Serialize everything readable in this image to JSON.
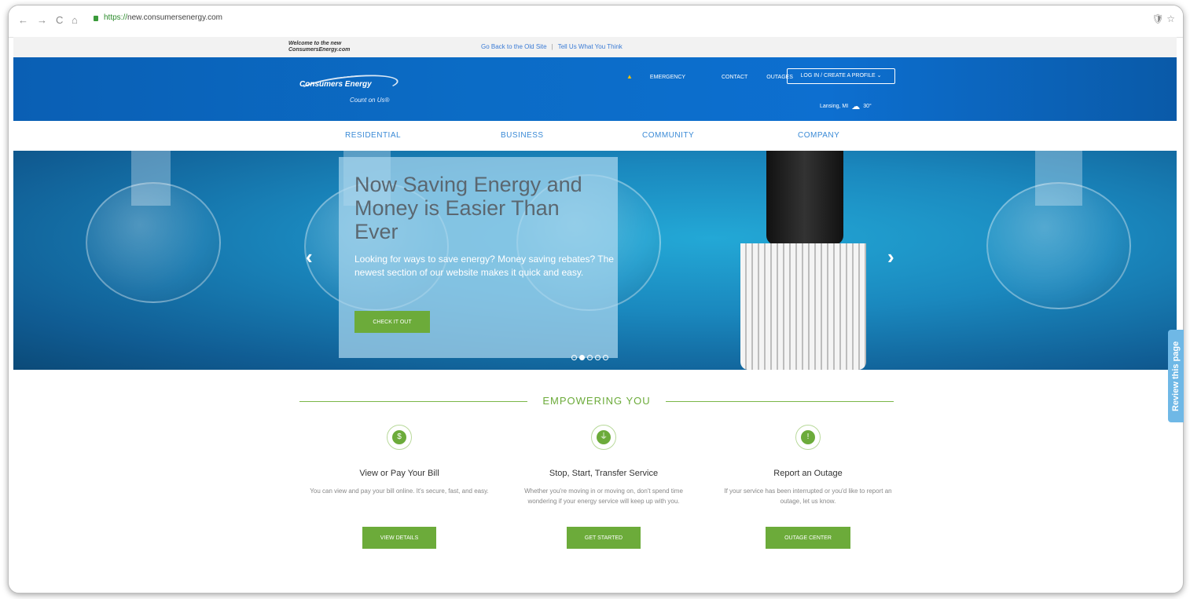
{
  "browser": {
    "back": "←",
    "forward": "→",
    "reload": "C",
    "home": "⌂",
    "url_scheme": "https://",
    "url_host": "new.consumersenergy.com",
    "right_icons": "🛡 ☆"
  },
  "topbar": {
    "welcome": "Welcome to the new ConsumersEnergy.com",
    "back_link": "Go Back to the Old Site",
    "separator": "|",
    "feedback_link": "Tell Us What You Think"
  },
  "header": {
    "logo_title": "Consumers Energy",
    "logo_tagline": "Count on Us®",
    "util_nav": [
      "EMERGENCY",
      "CONTACT",
      "OUTAGES"
    ],
    "login_label": "LOG IN / CREATE A PROFILE ⌄",
    "location": "Lansing, MI",
    "temperature": "30°"
  },
  "main_nav": [
    "RESIDENTIAL",
    "BUSINESS",
    "COMMUNITY",
    "COMPANY"
  ],
  "hero": {
    "title": "Now Saving Energy and Money is Easier Than Ever",
    "subtitle": "Looking for ways to save energy? Money saving rebates? The newest section of our website makes it quick and easy.",
    "button": "CHECK IT OUT",
    "prev": "‹",
    "next": "›"
  },
  "review_tab": "Review this page",
  "empowering": {
    "heading": "EMPOWERING YOU",
    "cards": [
      {
        "icon": "$",
        "title": "View or Pay Your Bill",
        "desc": "You can view and pay your bill online. It's secure, fast, and easy.",
        "button": "VIEW DETAILS"
      },
      {
        "icon": "⏚",
        "title": "Stop, Start, Transfer Service",
        "desc": "Whether you're moving in or moving on, don't spend time wondering if your energy service will keep up with you.",
        "button": "GET STARTED"
      },
      {
        "icon": "!",
        "title": "Report an Outage",
        "desc": "If your service has been interrupted or you'd like to report an outage, let us know.",
        "button": "OUTAGE CENTER"
      }
    ]
  }
}
